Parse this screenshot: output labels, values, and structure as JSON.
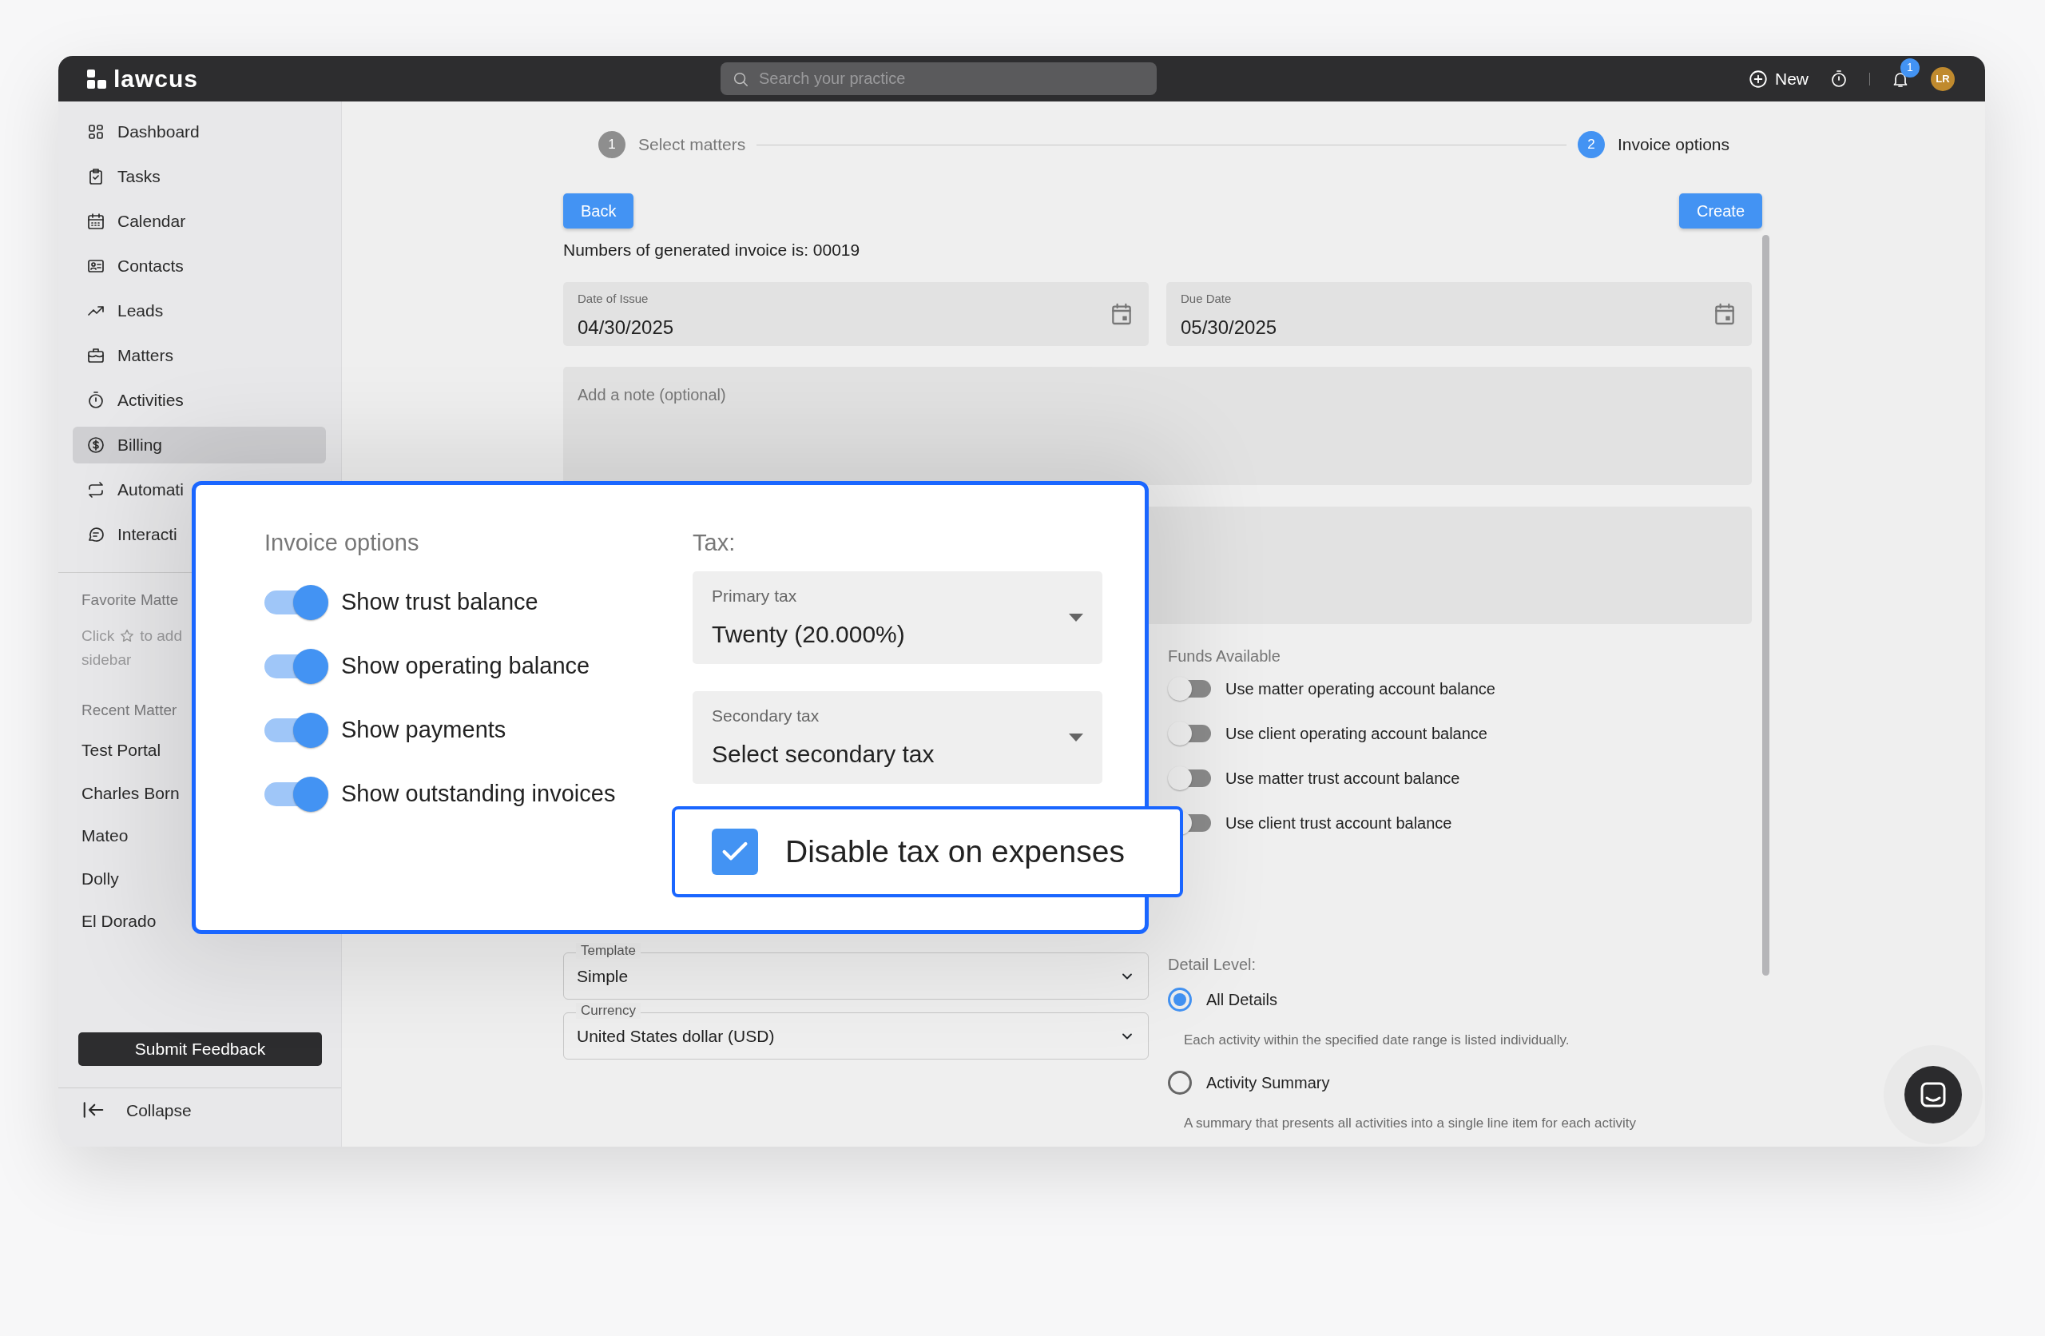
{
  "topbar": {
    "logo": "lawcus",
    "search": {
      "placeholder": "Search your practice"
    },
    "new_button": "New",
    "notification_badge": "1",
    "avatar": "LR"
  },
  "sidebar": {
    "items": [
      {
        "label": "Dashboard",
        "selected": false
      },
      {
        "label": "Tasks",
        "selected": false
      },
      {
        "label": "Calendar",
        "selected": false
      },
      {
        "label": "Contacts",
        "selected": false
      },
      {
        "label": "Leads",
        "selected": false
      },
      {
        "label": "Matters",
        "selected": false
      },
      {
        "label": "Activities",
        "selected": false
      },
      {
        "label": "Billing",
        "selected": true
      },
      {
        "label": "Automati",
        "selected": false
      },
      {
        "label": "Interacti",
        "selected": false
      }
    ],
    "favorites": {
      "heading": "Favorite Matte",
      "hint_start": "Click",
      "hint_end": "to add",
      "hint_line2": "sidebar"
    },
    "recent": {
      "heading": "Recent Matter",
      "items": [
        "Test Portal",
        "Charles Born",
        "Mateo",
        "Dolly",
        "El Dorado"
      ]
    },
    "feedback_button": "Submit Feedback",
    "collapse": "Collapse"
  },
  "stepper": [
    {
      "number": "1",
      "label": "Select matters",
      "selected": false
    },
    {
      "number": "2",
      "label": "Invoice options",
      "selected": true
    }
  ],
  "back_button": "Back",
  "create_button": "Create",
  "invoice_count": "Numbers of generated invoice is: 00019",
  "dates": [
    {
      "label": "Date of Issue",
      "value": "04/30/2025"
    },
    {
      "label": "Due Date",
      "value": "05/30/2025"
    }
  ],
  "note": {
    "placeholder": "Add a note (optional)"
  },
  "selects": [
    {
      "label": "Template",
      "value": "Simple"
    },
    {
      "label": "Currency",
      "value": "United States dollar (USD)"
    }
  ],
  "funds": {
    "heading": "Funds Available",
    "toggles": [
      {
        "label": "Use matter operating account balance",
        "on": false
      },
      {
        "label": "Use client operating account balance",
        "on": false
      },
      {
        "label": "Use matter trust account balance",
        "on": false
      },
      {
        "label": "Use client trust account balance",
        "on": false
      }
    ]
  },
  "detail_level": {
    "heading": "Detail Level:",
    "options": [
      {
        "label": "All Details",
        "description": "Each activity within the specified date range is listed individually.",
        "selected": true
      },
      {
        "label": "Activity Summary",
        "description": "A summary that presents all activities into a single line item for each activity",
        "selected": false
      }
    ]
  },
  "popup": {
    "heading": "Invoice options",
    "toggles": [
      {
        "label": "Show trust balance",
        "on": true
      },
      {
        "label": "Show operating balance",
        "on": true
      },
      {
        "label": "Show payments",
        "on": true
      },
      {
        "label": "Show outstanding invoices",
        "on": true
      }
    ],
    "tax_heading": "Tax:",
    "taxes": [
      {
        "label": "Primary tax",
        "value": "Twenty (20.000%)"
      },
      {
        "label": "Secondary tax",
        "value": "Select secondary tax"
      }
    ]
  },
  "callout": {
    "label": "Disable tax on expenses",
    "checked": true
  }
}
